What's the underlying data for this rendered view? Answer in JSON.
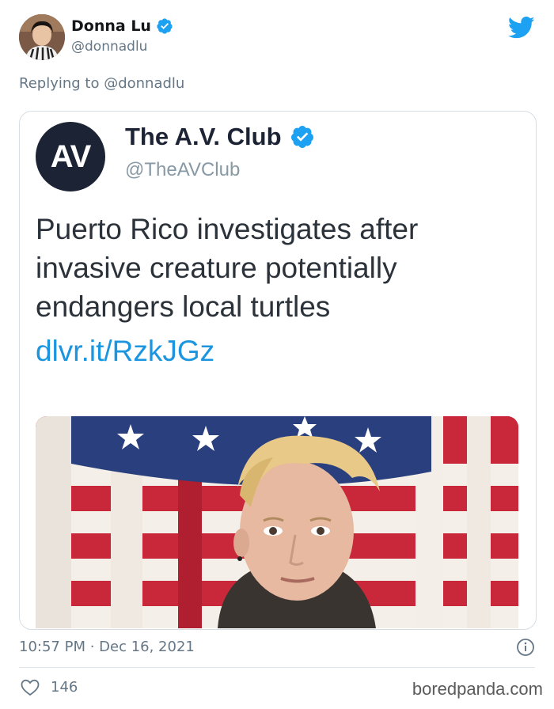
{
  "author": {
    "name": "Donna Lu",
    "handle": "@donnadlu",
    "verified": true,
    "avatar_icon": "profile-photo"
  },
  "reply": {
    "text": "Replying to @donnadlu"
  },
  "quoted_tweet": {
    "avatar_text": "AV",
    "name": "The A.V. Club",
    "handle": "@TheAVClub",
    "verified": true,
    "text_lines": [
      "Puerto Rico investigates after",
      "invasive creature potentially",
      "endangers local turtles"
    ],
    "link": "dlvr.it/RzkJGz",
    "media_description_icon": "flag-photo"
  },
  "meta": {
    "timestamp": "10:57 PM · Dec 16, 2021",
    "likes": "146"
  },
  "watermark": "boredpanda.com",
  "colors": {
    "verified_blue": "#1da1f2",
    "link_blue": "#1b95e0",
    "av_navy": "#1c2334",
    "muted_gray": "#657786"
  }
}
